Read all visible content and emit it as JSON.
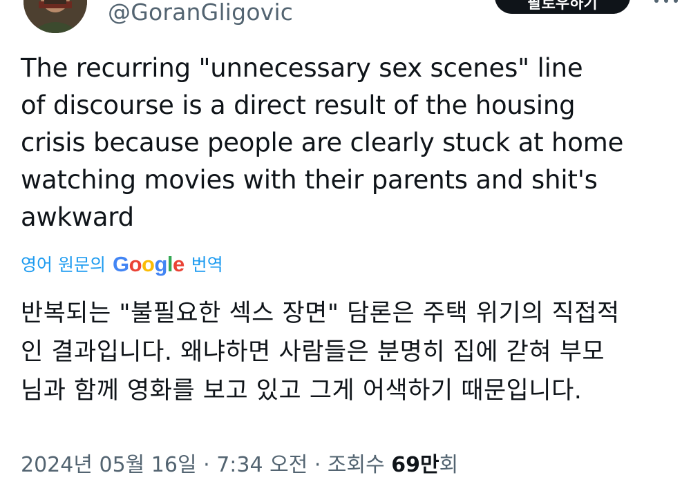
{
  "author": {
    "handle": "@GoranGligovic",
    "avatar_icon": "profile-photo-avatar"
  },
  "header": {
    "follow_label": "팔로우하기",
    "more_icon": "more-options-icon"
  },
  "tweet": {
    "lines": [
      "The recurring \"unnecessary sex scenes\" line",
      "of discourse is a direct result of the housing",
      "crisis because people are clearly stuck at home",
      "watching movies with their parents and shit's",
      "awkward"
    ]
  },
  "translation": {
    "prefix": "영어 원문의",
    "google_letters": [
      "G",
      "o",
      "o",
      "g",
      "l",
      "e"
    ],
    "google_colors": [
      "#4285F4",
      "#EA4335",
      "#FBBC05",
      "#4285F4",
      "#34A853",
      "#EA4335"
    ],
    "suffix": "번역",
    "lines": [
      "반복되는 \"불필요한 섹스 장면\" 담론은 주택 위기의 직접적",
      "인 결과입니다. 왜냐하면 사람들은 분명히 집에 갇혀 부모",
      "님과 함께 영화를 보고 있고 그게 어색하기 때문입니다."
    ]
  },
  "meta": {
    "date": "2024년 05월 16일",
    "separator_1": " · ",
    "time": "7:34 오전",
    "separator_2": " · ",
    "views_label": "조회수",
    "views_count": "69만",
    "views_suffix": "회"
  },
  "colors": {
    "link_blue": "#1d9bf0",
    "text_primary": "#0f1419",
    "text_secondary": "#536471"
  }
}
